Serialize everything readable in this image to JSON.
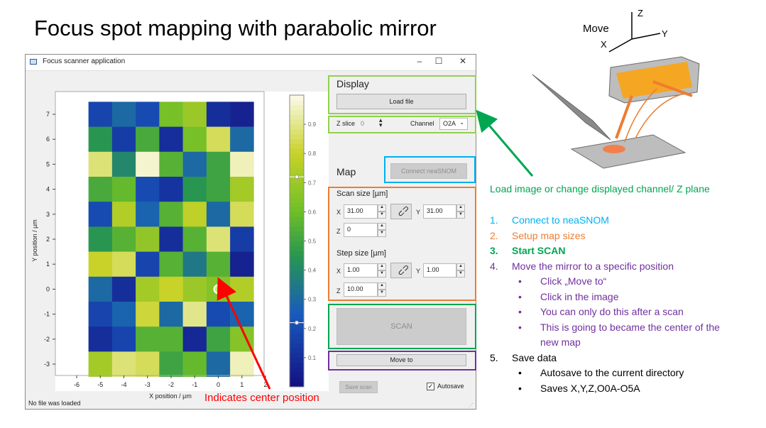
{
  "slide": {
    "title": "Focus spot mapping with parabolic mirror",
    "annotation_display": "Load image or change displayed channel/ Z plane",
    "annotation_center": "Indicates center position"
  },
  "window": {
    "title": "Focus scanner application",
    "status": "No file was loaded"
  },
  "display": {
    "heading": "Display",
    "load_file": "Load file",
    "zslice_label": "Z slice",
    "zslice_value": "0",
    "channel_label": "Channel",
    "channel_value": "O2A"
  },
  "map": {
    "heading": "Map",
    "connect": "Connect neaSNOM",
    "scan_size_label": "Scan size [µm]",
    "step_size_label": "Step size [µm]",
    "x_label": "X",
    "y_label": "Y",
    "z_label": "Z",
    "scan_x": "31.00",
    "scan_y": "31.00",
    "scan_z": "0",
    "step_x": "1.00",
    "step_y": "1.00",
    "step_z": "10.00",
    "scan_button": "SCAN",
    "move_to": "Move to",
    "save_scan": "Save scan",
    "autosave": "Autosave"
  },
  "diagram": {
    "move": "Move",
    "x": "X",
    "y": "Y",
    "z": "Z"
  },
  "steps": {
    "s1": "Connect to neaSNOM",
    "s2": "Setup map sizes",
    "s3": "Start SCAN",
    "s4": "Move the mirror to a specific position",
    "s4a": "Click „Move to“",
    "s4b": "Click in the image",
    "s4c": "You can only do this after a scan",
    "s4d": "This is going to became the center of the",
    "s4d2": "new map",
    "s5": "Save data",
    "s5a": "Autosave to the current directory",
    "s5b": "Saves X,Y,Z,O0A-O5A"
  },
  "colors": {
    "green": "#00a651",
    "cyan": "#00b0f0",
    "orange": "#ed7d31",
    "purple": "#7030a0",
    "red": "#ff0000",
    "box_green": "#92d050"
  },
  "chart_data": {
    "type": "heatmap",
    "xlabel": "X position / µm",
    "ylabel": "Y position / µm",
    "xticks": [
      "-6",
      "-5",
      "-4",
      "-3",
      "-2",
      "-1",
      "0",
      "1",
      "2"
    ],
    "yticks": [
      "7",
      "6",
      "5",
      "4",
      "3",
      "2",
      "1",
      "0",
      "-1",
      "-2",
      "-3"
    ],
    "colorbar_ticks": [
      "0.9",
      "0.8",
      "0.7",
      "0.6",
      "0.5",
      "0.4",
      "0.3",
      "0.2",
      "0.1"
    ],
    "colorbar_range": [
      0.0,
      1.0
    ],
    "colormap": "viridis-like (dark blue to green to yellow)",
    "cell_x_centers": [
      -5,
      -4,
      -3,
      -2,
      -1,
      0,
      1
    ],
    "cell_y_centers": [
      7,
      6,
      5,
      4,
      3,
      2,
      1,
      0,
      -1,
      -2,
      -3
    ],
    "values": [
      [
        0.18,
        0.3,
        0.2,
        0.62,
        0.7,
        0.1,
        0.06
      ],
      [
        0.45,
        0.15,
        0.52,
        0.1,
        0.62,
        0.85,
        0.3
      ],
      [
        0.88,
        0.4,
        0.97,
        0.55,
        0.3,
        0.5,
        0.95
      ],
      [
        0.52,
        0.58,
        0.2,
        0.12,
        0.45,
        0.5,
        0.72
      ],
      [
        0.2,
        0.75,
        0.28,
        0.55,
        0.78,
        0.3,
        0.85
      ],
      [
        0.45,
        0.55,
        0.68,
        0.1,
        0.55,
        0.88,
        0.15
      ],
      [
        0.8,
        0.85,
        0.18,
        0.55,
        0.35,
        0.55,
        0.06
      ],
      [
        0.3,
        0.1,
        0.72,
        0.8,
        0.7,
        0.65,
        0.75
      ],
      [
        0.18,
        0.28,
        0.82,
        0.3,
        0.9,
        0.2,
        0.28
      ],
      [
        0.1,
        0.18,
        0.55,
        0.55,
        0.08,
        0.5,
        0.65
      ],
      [
        0.72,
        0.88,
        0.85,
        0.5,
        0.58,
        0.3,
        0.95
      ]
    ],
    "center_marker": [
      0,
      0
    ]
  }
}
